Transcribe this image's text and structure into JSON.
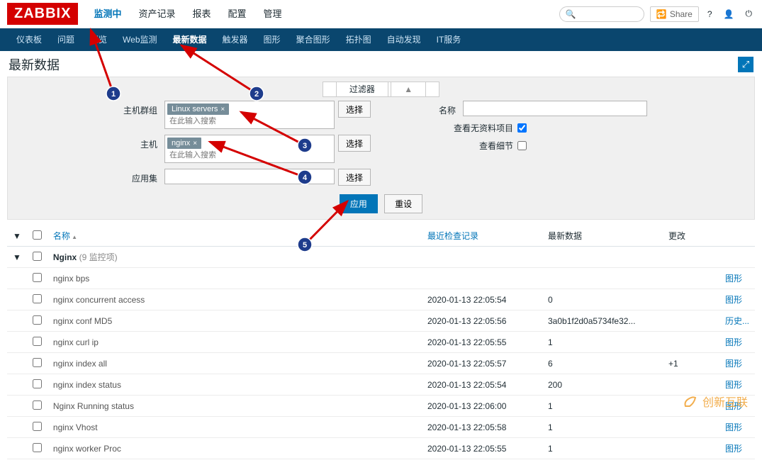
{
  "logo": "ZABBIX",
  "top_nav": {
    "items": [
      "监测中",
      "资产记录",
      "报表",
      "配置",
      "管理"
    ],
    "active": "监测中",
    "share": "Share"
  },
  "sub_nav": {
    "items": [
      "仪表板",
      "问题",
      "概览",
      "Web监测",
      "最新数据",
      "触发器",
      "图形",
      "聚合图形",
      "拓扑图",
      "自动发现",
      "IT服务"
    ],
    "active": "最新数据"
  },
  "page_title": "最新数据",
  "filter": {
    "toggle_label": "过滤器",
    "labels": {
      "hostgroup": "主机群组",
      "host": "主机",
      "application": "应用集",
      "name": "名称",
      "show_empty": "查看无资料项目",
      "show_details": "查看细节"
    },
    "hostgroup_tag": "Linux servers",
    "host_tag": "nginx",
    "placeholder": "在此输入搜索",
    "select_btn": "选择",
    "apply": "应用",
    "reset": "重设",
    "show_empty_checked": true,
    "show_details_checked": false
  },
  "table": {
    "columns": {
      "name": "名称",
      "last_check": "最近检查记录",
      "last_data": "最新数据",
      "change": "更改"
    },
    "group": {
      "name": "Nginx",
      "count_label": "(9 监控项)"
    },
    "rows": [
      {
        "name": "nginx bps",
        "last_check": "",
        "last_data": "",
        "change": "",
        "action": "图形"
      },
      {
        "name": "nginx concurrent access",
        "last_check": "2020-01-13 22:05:54",
        "last_data": "0",
        "change": "",
        "action": "图形"
      },
      {
        "name": "nginx conf MD5",
        "last_check": "2020-01-13 22:05:56",
        "last_data": "3a0b1f2d0a5734fe32...",
        "change": "",
        "action": "历史..."
      },
      {
        "name": "nginx curl ip",
        "last_check": "2020-01-13 22:05:55",
        "last_data": "1",
        "change": "",
        "action": "图形"
      },
      {
        "name": "nginx index all",
        "last_check": "2020-01-13 22:05:57",
        "last_data": "6",
        "change": "+1",
        "action": "图形"
      },
      {
        "name": "nginx index status",
        "last_check": "2020-01-13 22:05:54",
        "last_data": "200",
        "change": "",
        "action": "图形"
      },
      {
        "name": "Nginx Running status",
        "last_check": "2020-01-13 22:06:00",
        "last_data": "1",
        "change": "",
        "action": "图形"
      },
      {
        "name": "nginx Vhost",
        "last_check": "2020-01-13 22:05:58",
        "last_data": "1",
        "change": "",
        "action": "图形"
      },
      {
        "name": "nginx worker Proc",
        "last_check": "2020-01-13 22:05:55",
        "last_data": "1",
        "change": "",
        "action": "图形"
      }
    ]
  },
  "watermark": "创新互联"
}
